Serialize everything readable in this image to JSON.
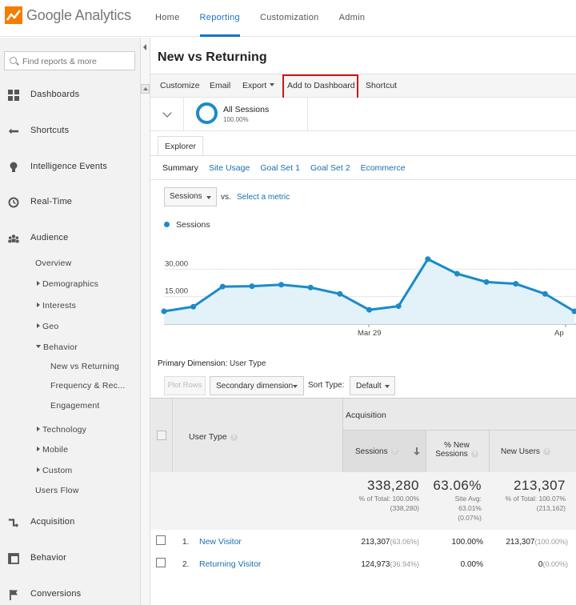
{
  "header": {
    "logo_text": "Google Analytics",
    "nav": [
      "Home",
      "Reporting",
      "Customization",
      "Admin"
    ],
    "active_nav": "Reporting"
  },
  "sidebar": {
    "search_placeholder": "Find reports & more",
    "main_items": [
      {
        "label": "Dashboards",
        "icon": "dashboard-icon"
      },
      {
        "label": "Shortcuts",
        "icon": "shortcuts-icon"
      },
      {
        "label": "Intelligence Events",
        "icon": "lightbulb-icon"
      },
      {
        "label": "Real-Time",
        "icon": "clock-icon"
      },
      {
        "label": "Audience",
        "icon": "people-icon"
      },
      {
        "label": "Acquisition",
        "icon": "acquisition-icon"
      },
      {
        "label": "Behavior",
        "icon": "behavior-icon"
      },
      {
        "label": "Conversions",
        "icon": "flag-icon"
      }
    ],
    "audience_sub": {
      "overview": "Overview",
      "demographics": "Demographics",
      "interests": "Interests",
      "geo": "Geo",
      "behavior": "Behavior",
      "new_vs_returning": "New vs Returning",
      "frequency": "Frequency & Rec...",
      "engagement": "Engagement",
      "technology": "Technology",
      "mobile": "Mobile",
      "custom": "Custom",
      "users_flow": "Users Flow"
    }
  },
  "page": {
    "title": "New vs Returning",
    "toolbar": {
      "customize": "Customize",
      "email": "Email",
      "export": "Export",
      "add_to_dashboard": "Add to Dashboard",
      "shortcut": "Shortcut"
    },
    "segment": {
      "name": "All Sessions",
      "percent": "100.00%"
    },
    "explorer_tab": "Explorer",
    "subtabs": [
      "Summary",
      "Site Usage",
      "Goal Set 1",
      "Goal Set 2",
      "Ecommerce"
    ],
    "metric_select": "Sessions",
    "vs": "vs.",
    "select_metric": "Select a metric",
    "legend": "Sessions",
    "primary_dimension_label": "Primary Dimension:",
    "primary_dimension_value": "User Type",
    "plot_rows": "Plot Rows",
    "secondary_dimension": "Secondary dimension",
    "sort_type_label": "Sort Type:",
    "sort_type_value": "Default"
  },
  "colors": {
    "accent": "#1b8bc9",
    "link": "#1b6fb0",
    "highlight": "#d01515"
  },
  "chart_data": {
    "type": "area",
    "series": [
      {
        "name": "Sessions",
        "values": [
          7000,
          9500,
          20500,
          20700,
          21500,
          20000,
          16500,
          7800,
          9800,
          35500,
          27500,
          23000,
          22000,
          16500,
          7000
        ]
      }
    ],
    "y_ticks": [
      "30,000",
      "15,000"
    ],
    "x_ticks": [
      "Mar 29",
      "Ap"
    ],
    "ylim": [
      0,
      45000
    ],
    "grid": true
  },
  "table": {
    "user_type_header": "User Type",
    "group_header": "Acquisition",
    "columns": [
      "Sessions",
      "% New Sessions",
      "New Users"
    ],
    "totals": {
      "sessions": {
        "value": "338,280",
        "line1": "% of Total: 100.00%",
        "line2": "(338,280)"
      },
      "pct_new": {
        "value": "63.06%",
        "line1": "Site Avg:",
        "line2": "63.01%",
        "line3": "(0.07%)"
      },
      "new_users": {
        "value": "213,307",
        "line1": "% of Total: 100.07%",
        "line2": "(213,162)"
      }
    },
    "rows": [
      {
        "num": "1.",
        "type": "New Visitor",
        "sessions": "213,307",
        "sessions_pct": "(63.06%)",
        "pct_new": "100.00%",
        "new_users": "213,307",
        "new_users_pct": "(100.00%)"
      },
      {
        "num": "2.",
        "type": "Returning Visitor",
        "sessions": "124,973",
        "sessions_pct": "(36.94%)",
        "pct_new": "0.00%",
        "new_users": "0",
        "new_users_pct": "(0.00%)"
      }
    ]
  }
}
